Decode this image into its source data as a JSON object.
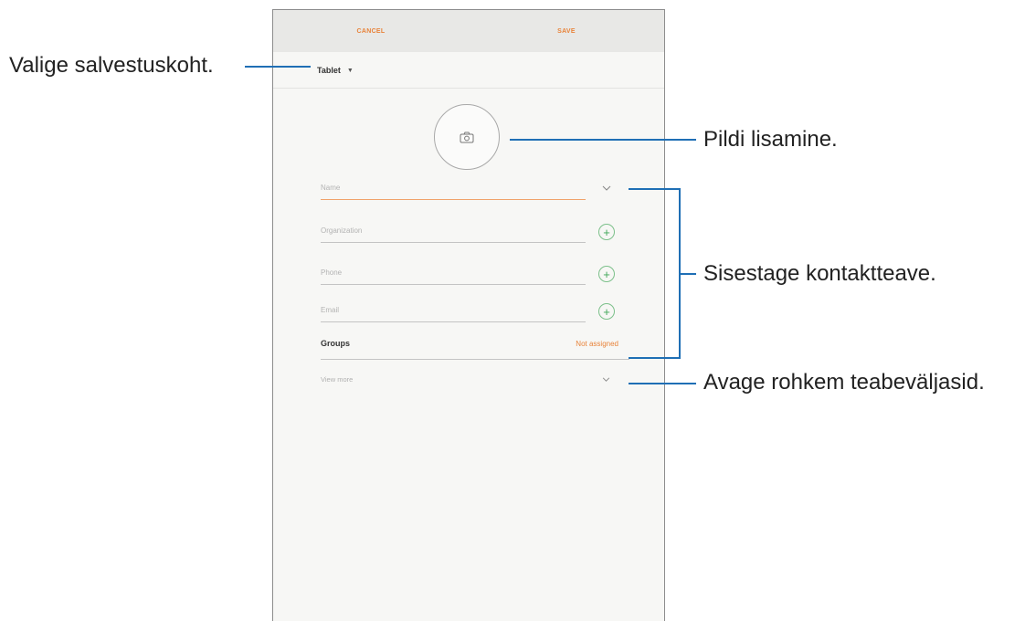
{
  "screen": {
    "topbar": {
      "cancel_label": "CANCEL",
      "save_label": "SAVE"
    },
    "storage": {
      "value": "Tablet",
      "caret_icon": "caret-down-icon"
    },
    "photo": {
      "icon": "camera-icon"
    },
    "fields": {
      "name": {
        "placeholder": "Name",
        "action_icon": "chevron-down-icon"
      },
      "organization": {
        "placeholder": "Organization",
        "action_icon": "plus-icon"
      },
      "phone": {
        "placeholder": "Phone",
        "action_icon": "plus-icon"
      },
      "email": {
        "placeholder": "Email",
        "action_icon": "plus-icon"
      }
    },
    "groups": {
      "label": "Groups",
      "value": "Not assigned"
    },
    "view_more": {
      "label": "View more",
      "icon": "chevron-down-icon"
    }
  },
  "callouts": {
    "storage": "Valige salvestuskoht.",
    "photo": "Pildi lisamine.",
    "contact_info": "Sisestage kontaktteave.",
    "more_fields": "Avage rohkem teabeväljasid."
  },
  "colors": {
    "accent": "#e8833a",
    "add": "#42a85a",
    "callout_line": "#1f6fb5"
  }
}
